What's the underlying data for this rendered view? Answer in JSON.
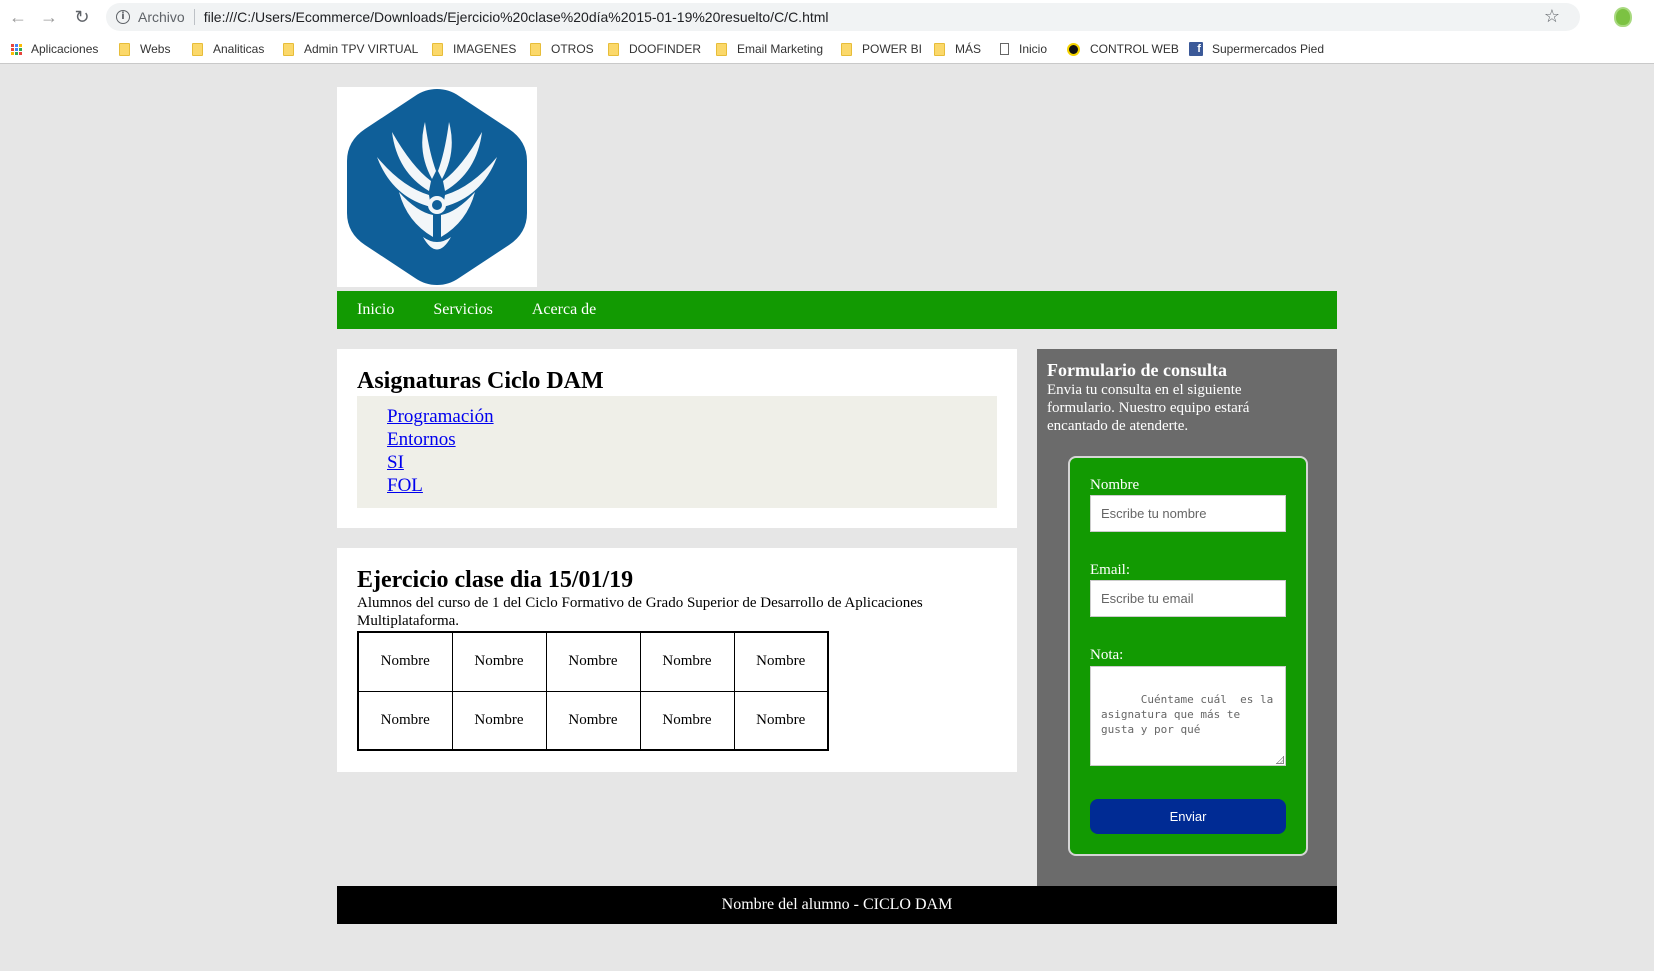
{
  "browser": {
    "scheme_label": "Archivo",
    "url": "file:///C:/Users/Ecommerce/Downloads/Ejercicio%20clase%20día%2015-01-19%20resuelto/C/C.html",
    "bookmarks": [
      {
        "label": "Aplicaciones",
        "icon": "apps-icon"
      },
      {
        "label": "Webs",
        "icon": "folder-icon"
      },
      {
        "label": "Analiticas",
        "icon": "folder-icon"
      },
      {
        "label": "Admin TPV VIRTUAL",
        "icon": "folder-icon"
      },
      {
        "label": "IMAGENES",
        "icon": "folder-icon"
      },
      {
        "label": "OTROS",
        "icon": "folder-icon"
      },
      {
        "label": "DOOFINDER",
        "icon": "folder-icon"
      },
      {
        "label": "Email Marketing",
        "icon": "folder-icon"
      },
      {
        "label": "POWER BI",
        "icon": "folder-icon"
      },
      {
        "label": "MÁS",
        "icon": "folder-icon"
      },
      {
        "label": "Inicio",
        "icon": "page-icon"
      },
      {
        "label": "CONTROL WEB",
        "icon": "power-icon"
      },
      {
        "label": "Supermercados Pied",
        "icon": "facebook-icon"
      }
    ]
  },
  "navbar": {
    "items": [
      "Inicio",
      "Servicios",
      "Acerca de"
    ],
    "color": "#129a02"
  },
  "subjects_card": {
    "title": "Asignaturas Ciclo DAM",
    "links": [
      "Programación",
      "Entornos",
      "SI",
      "FOL"
    ]
  },
  "exercise_card": {
    "title": "Ejercicio clase dia 15/01/19",
    "description": "Alumnos del curso de 1 del Ciclo Formativo de Grado Superior de Desarrollo de Aplicaciones Multiplataforma.",
    "table": [
      [
        "Nombre",
        "Nombre",
        "Nombre",
        "Nombre",
        "Nombre"
      ],
      [
        "Nombre",
        "Nombre",
        "Nombre",
        "Nombre",
        "Nombre"
      ]
    ]
  },
  "sidebar": {
    "title": "Formulario de consulta",
    "text": "Envia tu consulta en el siguiente formulario. Nuestro equipo estará encantado de atenderte.",
    "form": {
      "name_label": "Nombre",
      "name_placeholder": "Escribe tu nombre",
      "email_label": "Email:",
      "email_placeholder": "Escribe tu email",
      "note_label": "Nota:",
      "note_placeholder": "Cuéntame cuál  es la asignatura que más te gusta y por qué",
      "submit_label": "Enviar"
    }
  },
  "footer": {
    "text": "Nombre del alumno - CICLO DAM"
  }
}
